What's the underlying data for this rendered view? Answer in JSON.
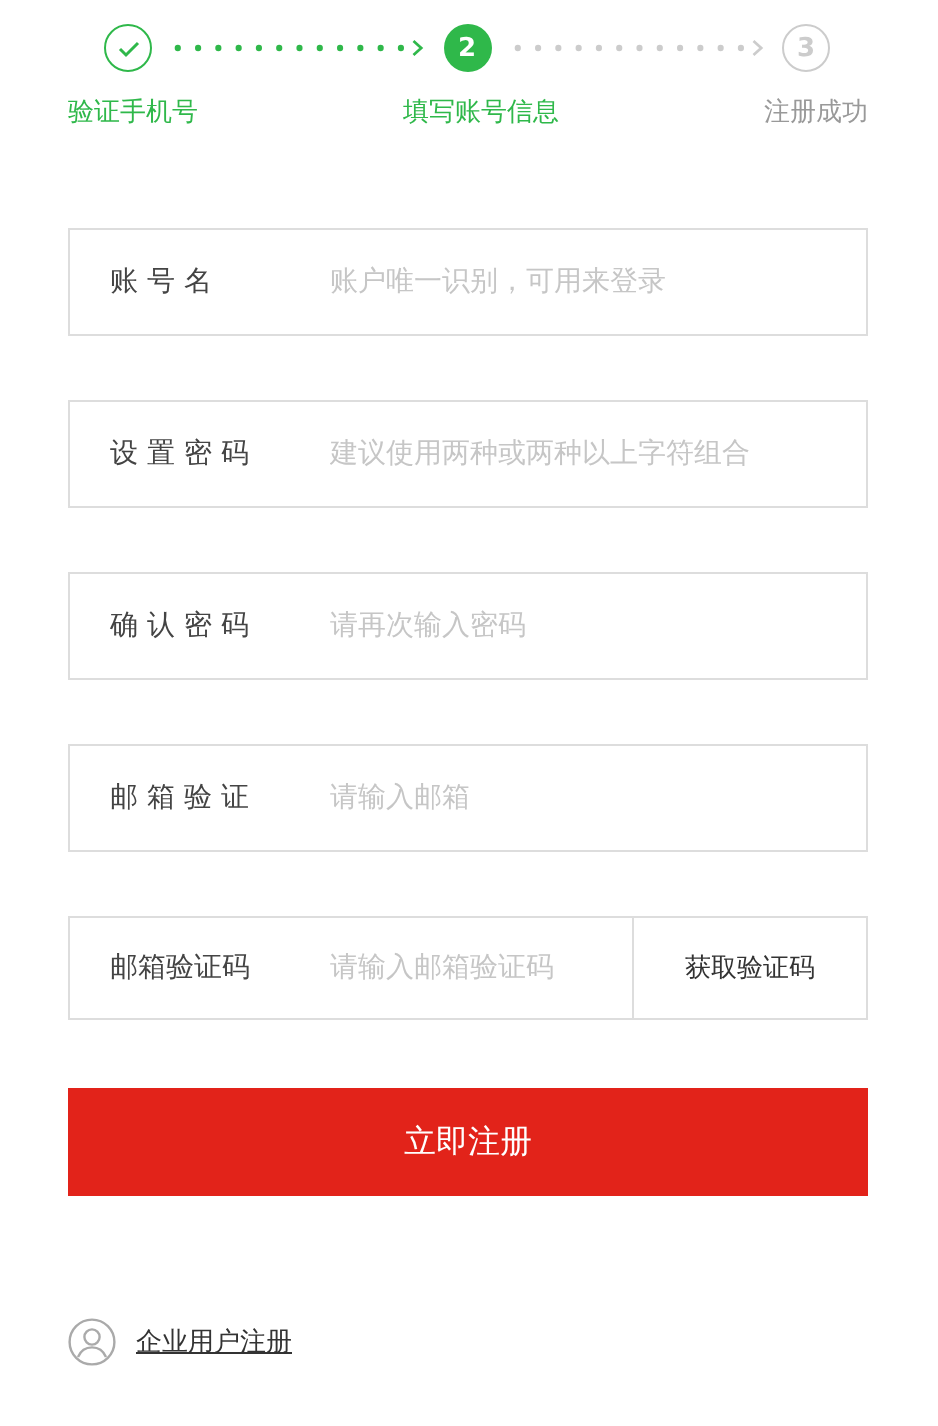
{
  "steps": [
    {
      "completed": true,
      "current": false,
      "label": "验证手机号"
    },
    {
      "completed": false,
      "current": true,
      "number": "2",
      "label": "填写账号信息"
    },
    {
      "completed": false,
      "current": false,
      "number": "3",
      "label": "注册成功"
    }
  ],
  "fields": [
    {
      "label": "账 号 名",
      "placeholder": "账户唯一识别，可用来登录"
    },
    {
      "label": "设 置 密 码",
      "placeholder": "建议使用两种或两种以上字符组合"
    },
    {
      "label": "确 认 密 码",
      "placeholder": "请再次输入密码"
    },
    {
      "label": "邮 箱 验 证",
      "placeholder": "请输入邮箱"
    },
    {
      "label": "邮箱验证码",
      "placeholder": "请输入邮箱验证码",
      "button": "获取验证码"
    }
  ],
  "submit": "立即注册",
  "company_link": "企业用户注册"
}
